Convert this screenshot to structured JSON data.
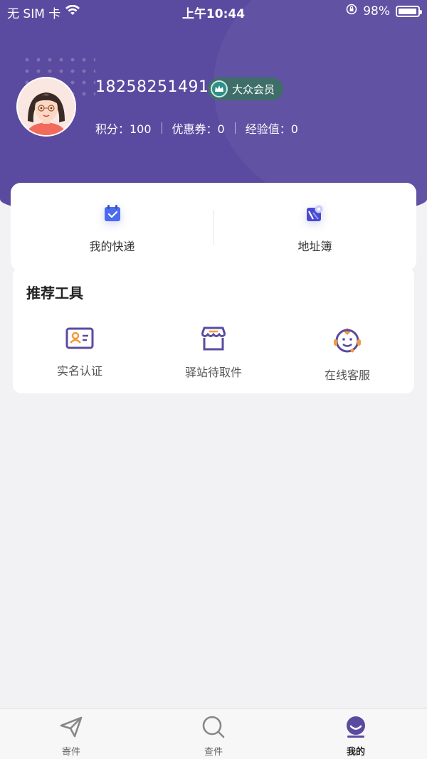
{
  "status_bar": {
    "carrier": "无 SIM 卡",
    "time": "上午10:44",
    "battery_percent": "98%",
    "battery_level": 0.98,
    "icons": [
      "wifi-icon",
      "orientation-lock-icon",
      "battery-icon"
    ]
  },
  "profile": {
    "phone": "18258251491",
    "member_level": "大众会员",
    "stats": {
      "points": "积分：100",
      "coupons": "优惠券：0",
      "experience": "经验值：0"
    }
  },
  "quick_actions": [
    {
      "label": "我的快递",
      "icon": "package-check-icon"
    },
    {
      "label": "地址簿",
      "icon": "map-pin-icon"
    }
  ],
  "tools": {
    "title": "推荐工具",
    "items": [
      {
        "label": "实名认证",
        "icon": "id-card-icon"
      },
      {
        "label": "驿站待取件",
        "icon": "store-icon"
      },
      {
        "label": "在线客服",
        "icon": "customer-service-icon"
      }
    ]
  },
  "tab_bar": {
    "items": [
      {
        "label": "寄件",
        "icon": "send-icon",
        "active": false
      },
      {
        "label": "查件",
        "icon": "search-icon",
        "active": false
      },
      {
        "label": "我的",
        "icon": "profile-icon",
        "active": true
      }
    ]
  },
  "colors": {
    "header": "#5b4ba0",
    "accent": "#5b4ba0",
    "tool_orange": "#f29a3c",
    "quick_blue": "#4a6cf0"
  }
}
